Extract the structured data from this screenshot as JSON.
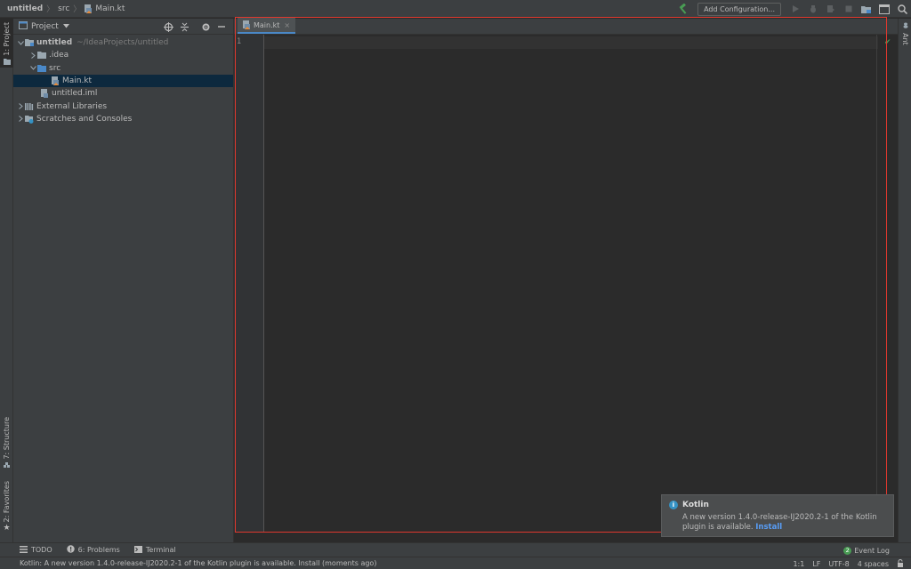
{
  "breadcrumbs": [
    {
      "label": "untitled"
    },
    {
      "label": "src"
    },
    {
      "label": "Main.kt"
    }
  ],
  "toolbar": {
    "add_configuration_label": "Add Configuration...",
    "icons": [
      "hammer-icon",
      "run-icon",
      "debug-icon",
      "coverage-icon",
      "stop-icon",
      "project-structure-icon",
      "layout-icon",
      "search-icon"
    ]
  },
  "left_strip": {
    "project_tab": "1: Project",
    "structure_tab": "7: Structure",
    "favorites_tab": "2: Favorites"
  },
  "right_strip": {
    "ant_tab": "Ant"
  },
  "project_panel": {
    "title": "Project",
    "tree": [
      {
        "label": "untitled",
        "path": "~/IdeaProjects/untitled"
      },
      {
        "label": ".idea"
      },
      {
        "label": "src"
      },
      {
        "label": "Main.kt"
      },
      {
        "label": "untitled.iml"
      },
      {
        "label": "External Libraries"
      },
      {
        "label": "Scratches and Consoles"
      }
    ]
  },
  "editor": {
    "tab_label": "Main.kt",
    "tab_close": "×",
    "line_numbers": [
      "1"
    ]
  },
  "notification": {
    "title": "Kotlin",
    "body": "A new version 1.4.0-release-IJ2020.2-1 of the Kotlin plugin is available.",
    "link": "Install"
  },
  "bottom_tabs": {
    "todo": "TODO",
    "problems": "6: Problems",
    "terminal": "Terminal",
    "event_log": "Event Log",
    "event_count": "2"
  },
  "status_bar": {
    "message": "Kotlin: A new version 1.4.0-release-IJ2020.2-1 of the Kotlin plugin is available. Install (moments ago)",
    "position": "1:1",
    "line_separator": "LF",
    "encoding": "UTF-8",
    "indent": "4 spaces"
  },
  "colors": {
    "accent": "#4a88c7",
    "highlight_frame": "#e0382e",
    "selection": "#0d293e",
    "success": "#499c54",
    "link": "#589df6"
  }
}
